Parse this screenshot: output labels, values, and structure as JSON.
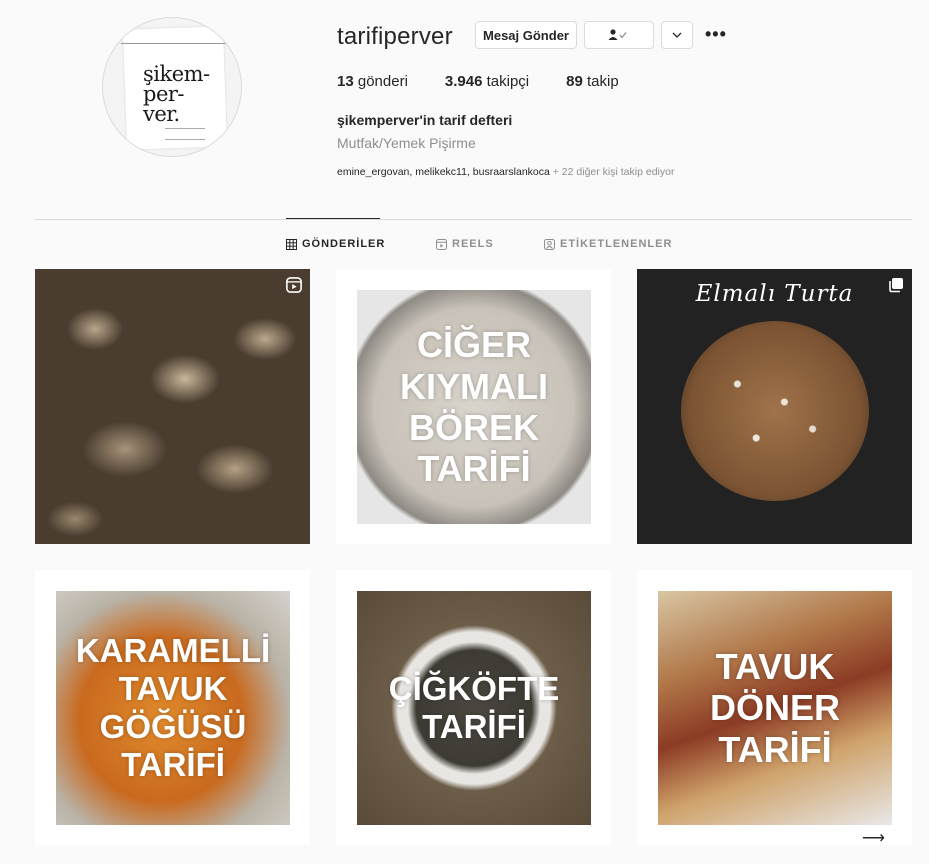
{
  "profile": {
    "username": "tarifiperver",
    "avatar_text": "şikem-\nper-\nver.",
    "message_button": "Mesaj Gönder",
    "more_options": "•••",
    "stats": {
      "posts_count": "13",
      "posts_label": "gönderi",
      "followers_count": "3.946",
      "followers_label": "takipçi",
      "following_count": "89",
      "following_label": "takip"
    },
    "full_name": "şikemperver'in tarif defteri",
    "category": "Mutfak/Yemek Pişirme",
    "followed_by_names": "emine_ergovan, melikekc11, busraarslankoca",
    "followed_by_more": " + 22 diğer kişi takip ediyor"
  },
  "tabs": [
    {
      "label": "GÖNDERİLER",
      "active": true
    },
    {
      "label": "REELS",
      "active": false
    },
    {
      "label": "ETİKETLENENLER",
      "active": false
    }
  ],
  "posts": [
    {
      "overlay_text": "",
      "badge": "reel-icon"
    },
    {
      "overlay_text": "CİĞER KIYMALI BÖREK TARİFİ",
      "badge": ""
    },
    {
      "overlay_text": "Elmalı Turta",
      "badge": "carousel-icon"
    },
    {
      "overlay_text": "KARAMELLİ TAVUK GÖĞÜSÜ TARİFİ",
      "badge": ""
    },
    {
      "overlay_text": "ÇİĞKÖFTE TARİFİ",
      "badge": ""
    },
    {
      "overlay_text": "TAVUK DÖNER TARİFİ",
      "badge": ""
    }
  ],
  "colors": {
    "text": "#262626",
    "muted": "#8e8e8e",
    "border": "#dbdbdb",
    "background": "#fafafa"
  }
}
